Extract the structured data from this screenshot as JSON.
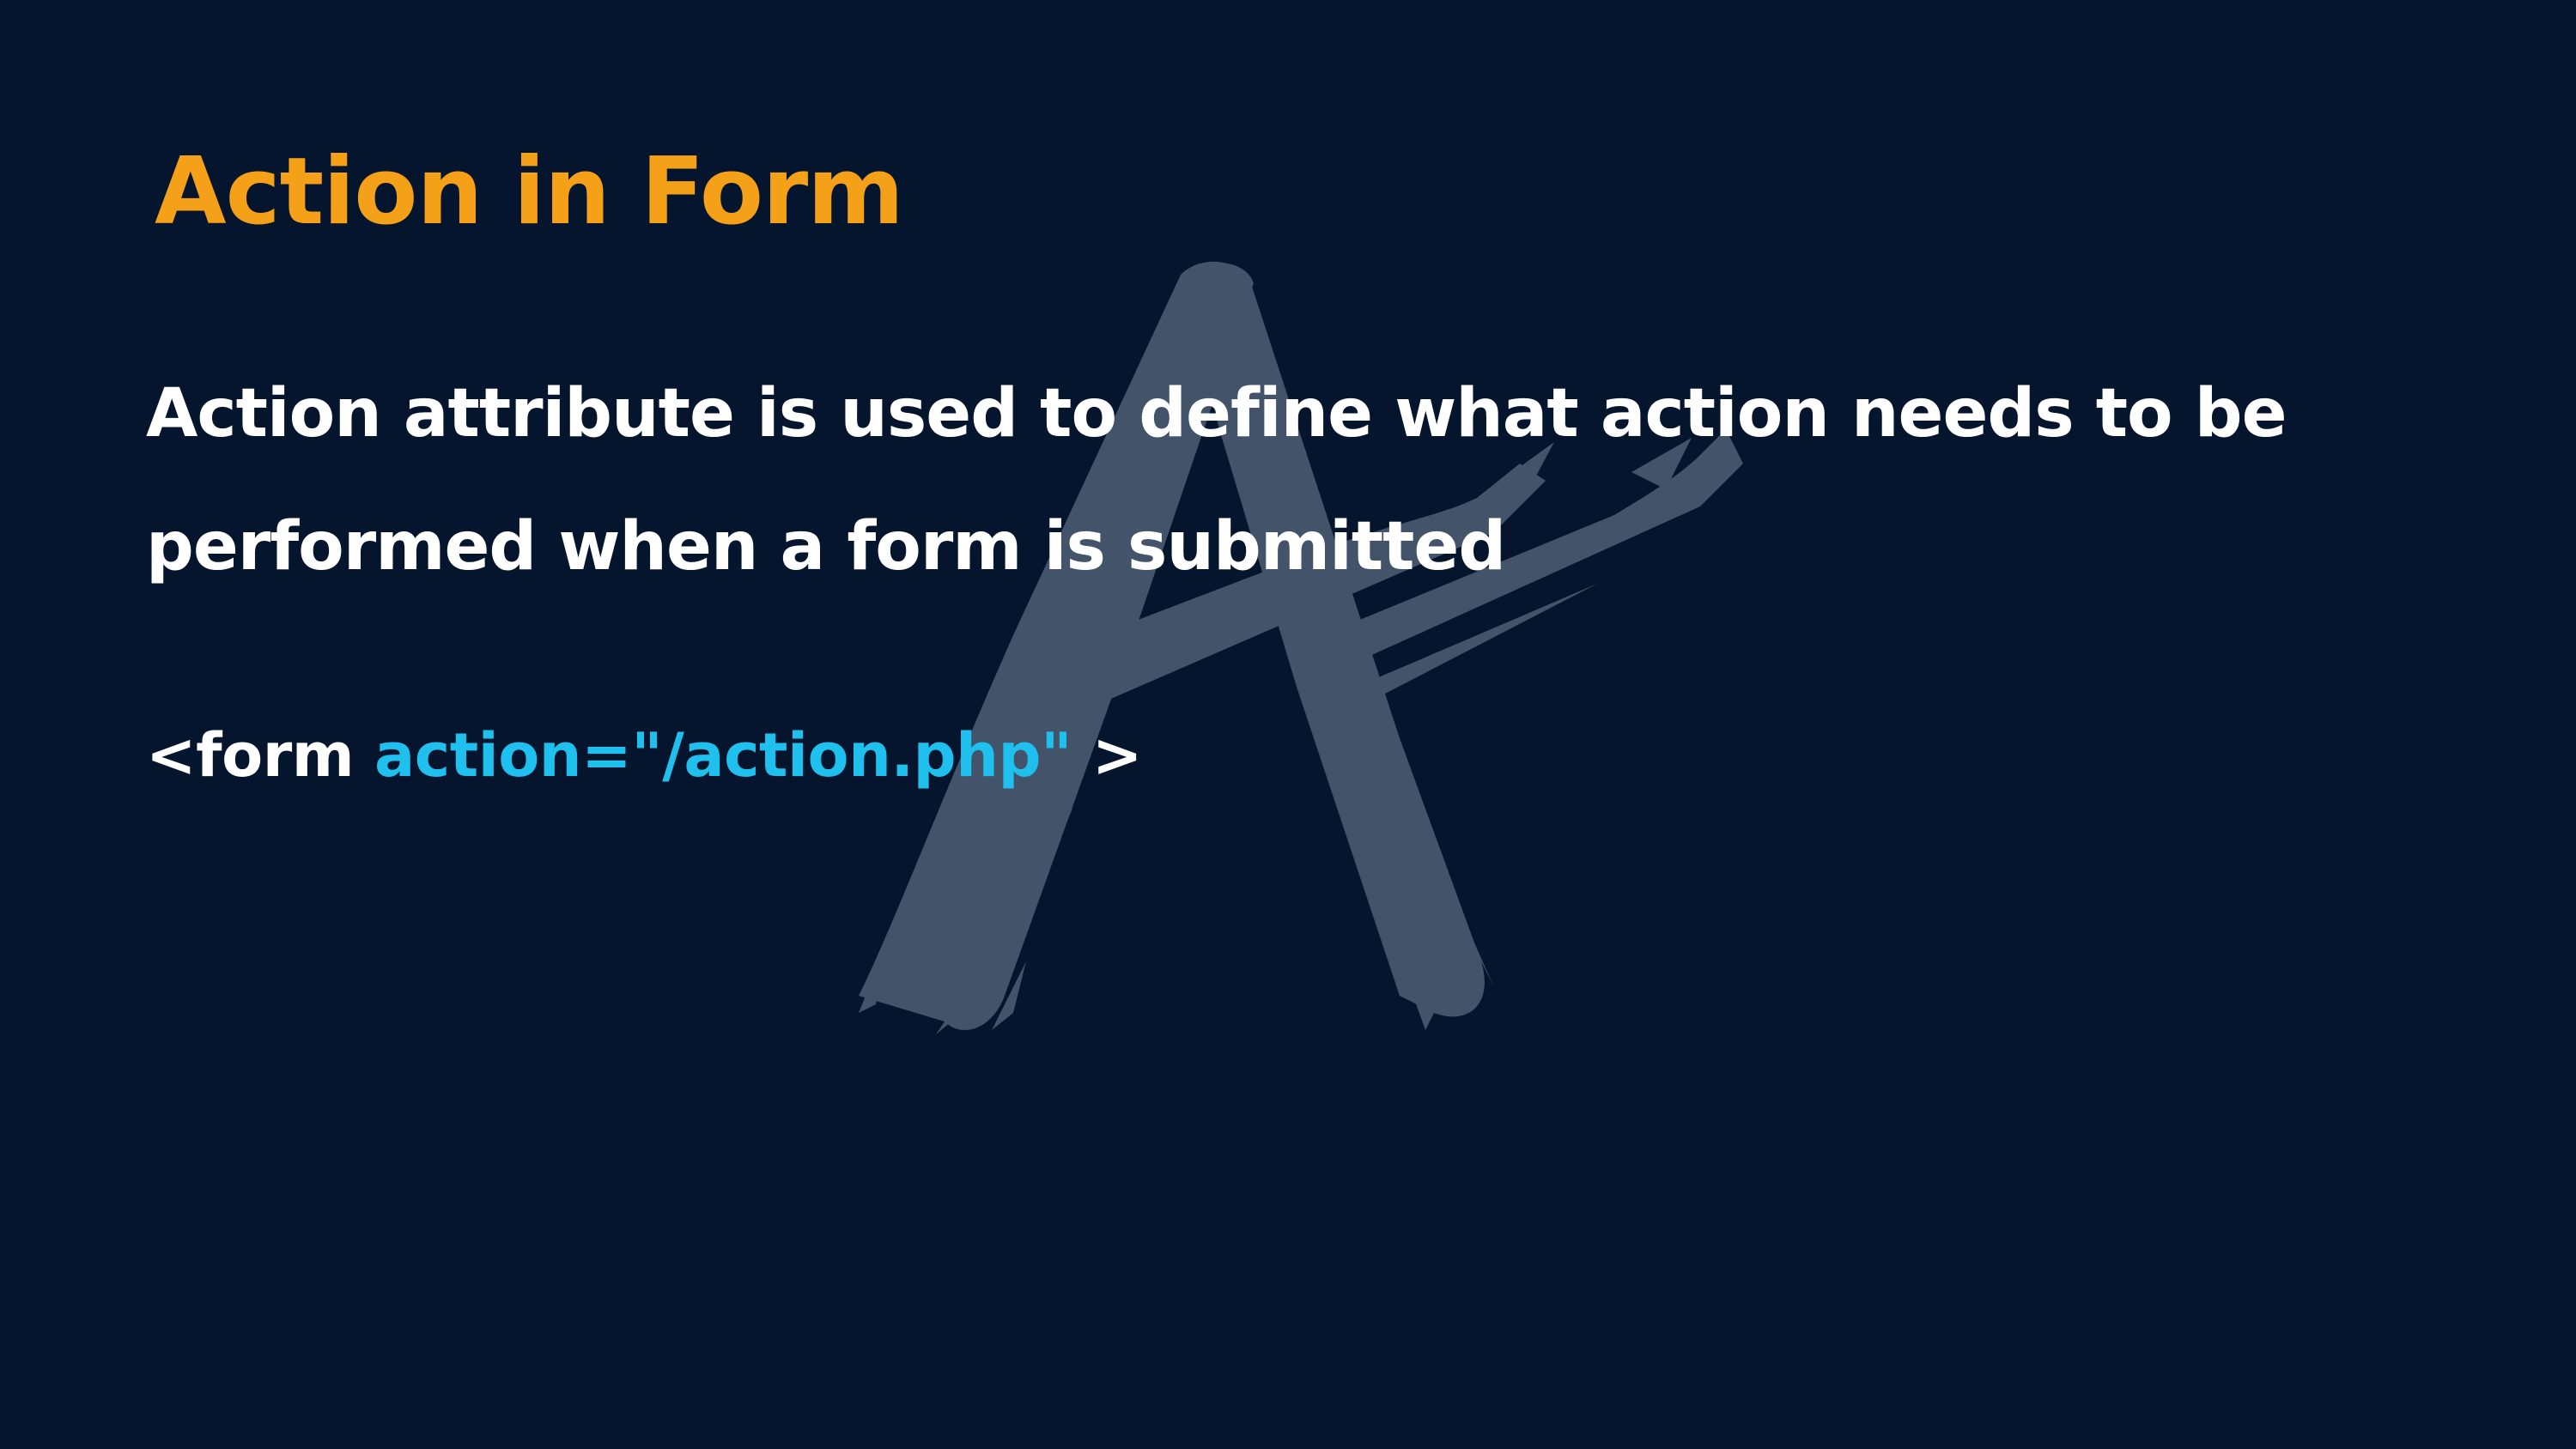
{
  "slide": {
    "title": "Action in Form",
    "description": "Action attribute is used to define what action needs to be performed when a form is submitted",
    "code": {
      "open_tag": "<form ",
      "attribute": "action=\"/action.php\"",
      "close_tag": " >"
    }
  },
  "watermark": {
    "icon": "brush-letter-a-logo"
  },
  "colors": {
    "background": "#04152d",
    "title": "#f5a019",
    "text": "#ffffff",
    "code_attribute": "#1fbfee",
    "watermark": "#43546a"
  }
}
